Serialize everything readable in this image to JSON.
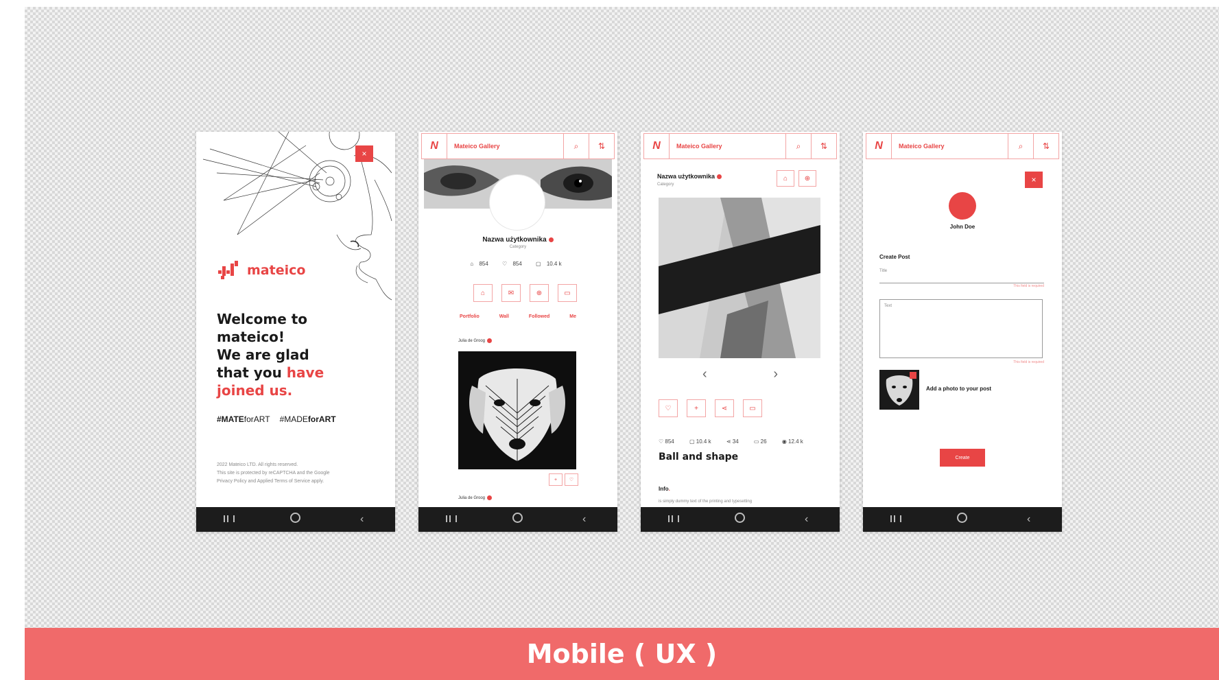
{
  "banner": {
    "title": "Mobile ( UX )"
  },
  "brand": {
    "accent": "#e84545",
    "banner_color": "#f06a6a",
    "logo_word": "mateico",
    "logo_mark": "N"
  },
  "welcome_screen": {
    "close_icon": "×",
    "line1": "Welcome to",
    "line2": "mateico!",
    "line3": "We are glad",
    "line4a": "that you ",
    "line4b": "have",
    "line5": "joined us.",
    "tag1_bold": "#MATE",
    "tag1_rest": "forART",
    "tag2_rest": "#MADE",
    "tag2_bold": "forART",
    "footer_line1": "2022 Mateico LTD. All rights reserved.",
    "footer_line2": "This site is protected by reCAPTCHA and the Google",
    "footer_line3": "Privacy Policy and Applied Terms of Service apply."
  },
  "appbar": {
    "title": "Mateico Gallery",
    "search_icon": "⌕",
    "sort_icon": "⇅"
  },
  "profile_screen": {
    "username": "Nazwa użytkownika",
    "category": "Category",
    "stats": [
      "854",
      "854",
      "10.4 k"
    ],
    "tabs": [
      "Portfolio",
      "Wall",
      "Followed",
      "Me"
    ],
    "author": "Julia de Groog",
    "author2": "Julia de Groog",
    "mini_actions": [
      "+",
      "♡"
    ]
  },
  "post_screen": {
    "username": "Nazwa użytkownika",
    "category": "Category",
    "stats": [
      "854",
      "10.4 k",
      "34",
      "26",
      "12.4 k"
    ],
    "title": "Ball and shape",
    "info_label": "Info",
    "info_text": "is simply dummy text of the printing and typesetting"
  },
  "create_screen": {
    "close_icon": "×",
    "user": "John Doe",
    "heading": "Create Post",
    "title_placeholder": "Title",
    "required_note": "This field is required",
    "text_placeholder": "Text",
    "required_note2": "This field is required",
    "add_photo": "Add a photo to your post",
    "create_button": "Create"
  }
}
